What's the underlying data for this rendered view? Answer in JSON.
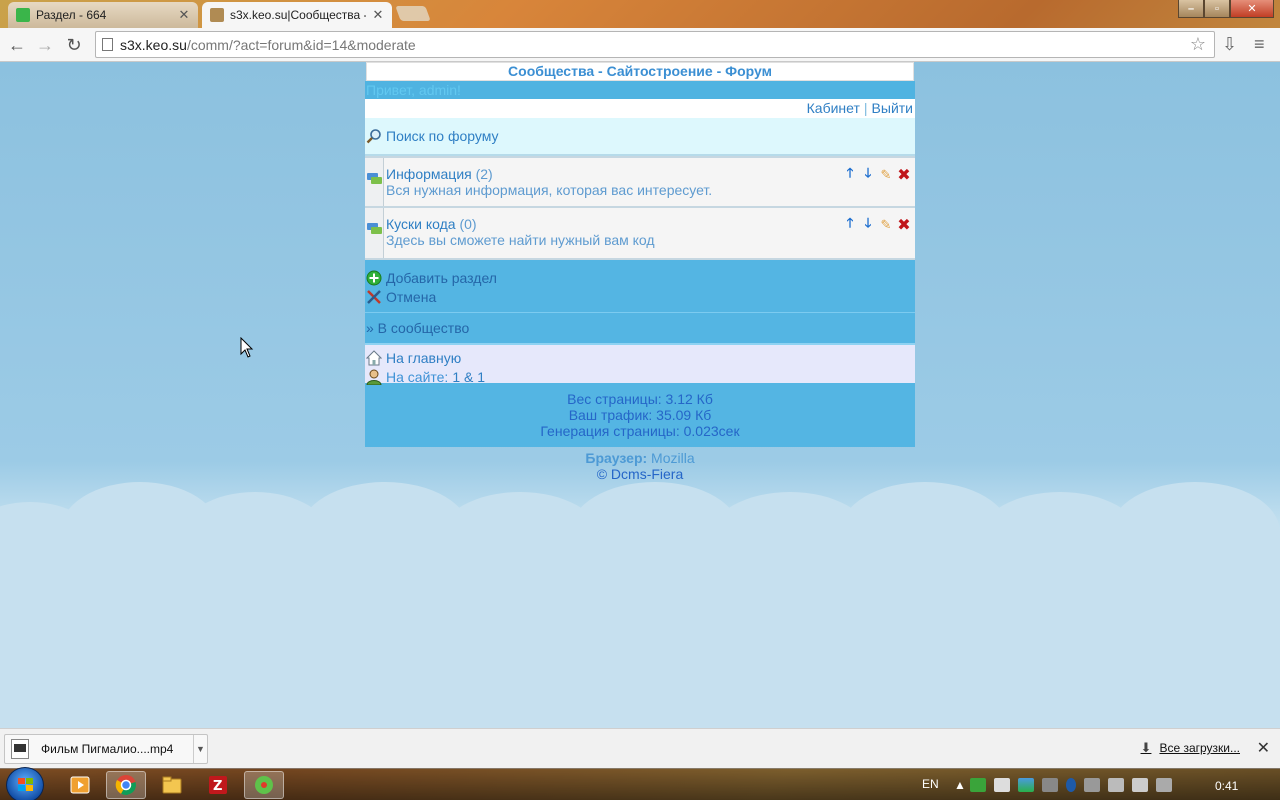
{
  "browser": {
    "tabs": [
      {
        "label": "Раздел - 664",
        "active": false,
        "favicon_color": "#3ab54a"
      },
      {
        "label": "s3x.keo.su|Сообщества -",
        "active": true,
        "favicon_color": "#8a6a3a"
      }
    ],
    "url_host": "s3x.keo.su",
    "url_path": "/comm/?act=forum&id=14&moderate"
  },
  "page": {
    "header": "Сообщества - Сайтостроение - Форум",
    "greeting": "Привет, admin!",
    "cabinet_link": "Кабинет",
    "separator": "|",
    "logout_link": "Выйти",
    "search_link": "Поиск по форуму",
    "forums": [
      {
        "name": "Информация",
        "count": "(2)",
        "description": "Вся нужная информация, которая вас интересует."
      },
      {
        "name": "Куски кода",
        "count": "(0)",
        "description": "Здесь вы сможете найти нужный вам код"
      }
    ],
    "add_section": "Добавить раздел",
    "cancel": "Отмена",
    "to_community": "» В сообщество",
    "home_link": "На главную",
    "online_label": "На сайте:",
    "online_value": "1 & 1",
    "stats": {
      "page_weight": "Вес страницы: 3.12 Кб",
      "traffic": "Ваш трафик: 35.09 Кб",
      "generation": "Генерация страницы: 0.023сек"
    },
    "footer_browser_label": "Браузер:",
    "footer_browser_value": "Mozilla",
    "footer_copyright": "© Dcms-Fiera"
  },
  "downloads": {
    "file_name": "Фильм Пигмалио....mp4",
    "all_downloads": "Все загрузки..."
  },
  "taskbar": {
    "lang": "EN",
    "clock": "0:41"
  },
  "colors": {
    "link": "#2f7fc4",
    "bar_blue": "#54b5e3",
    "sky": "#8fc2e0"
  }
}
